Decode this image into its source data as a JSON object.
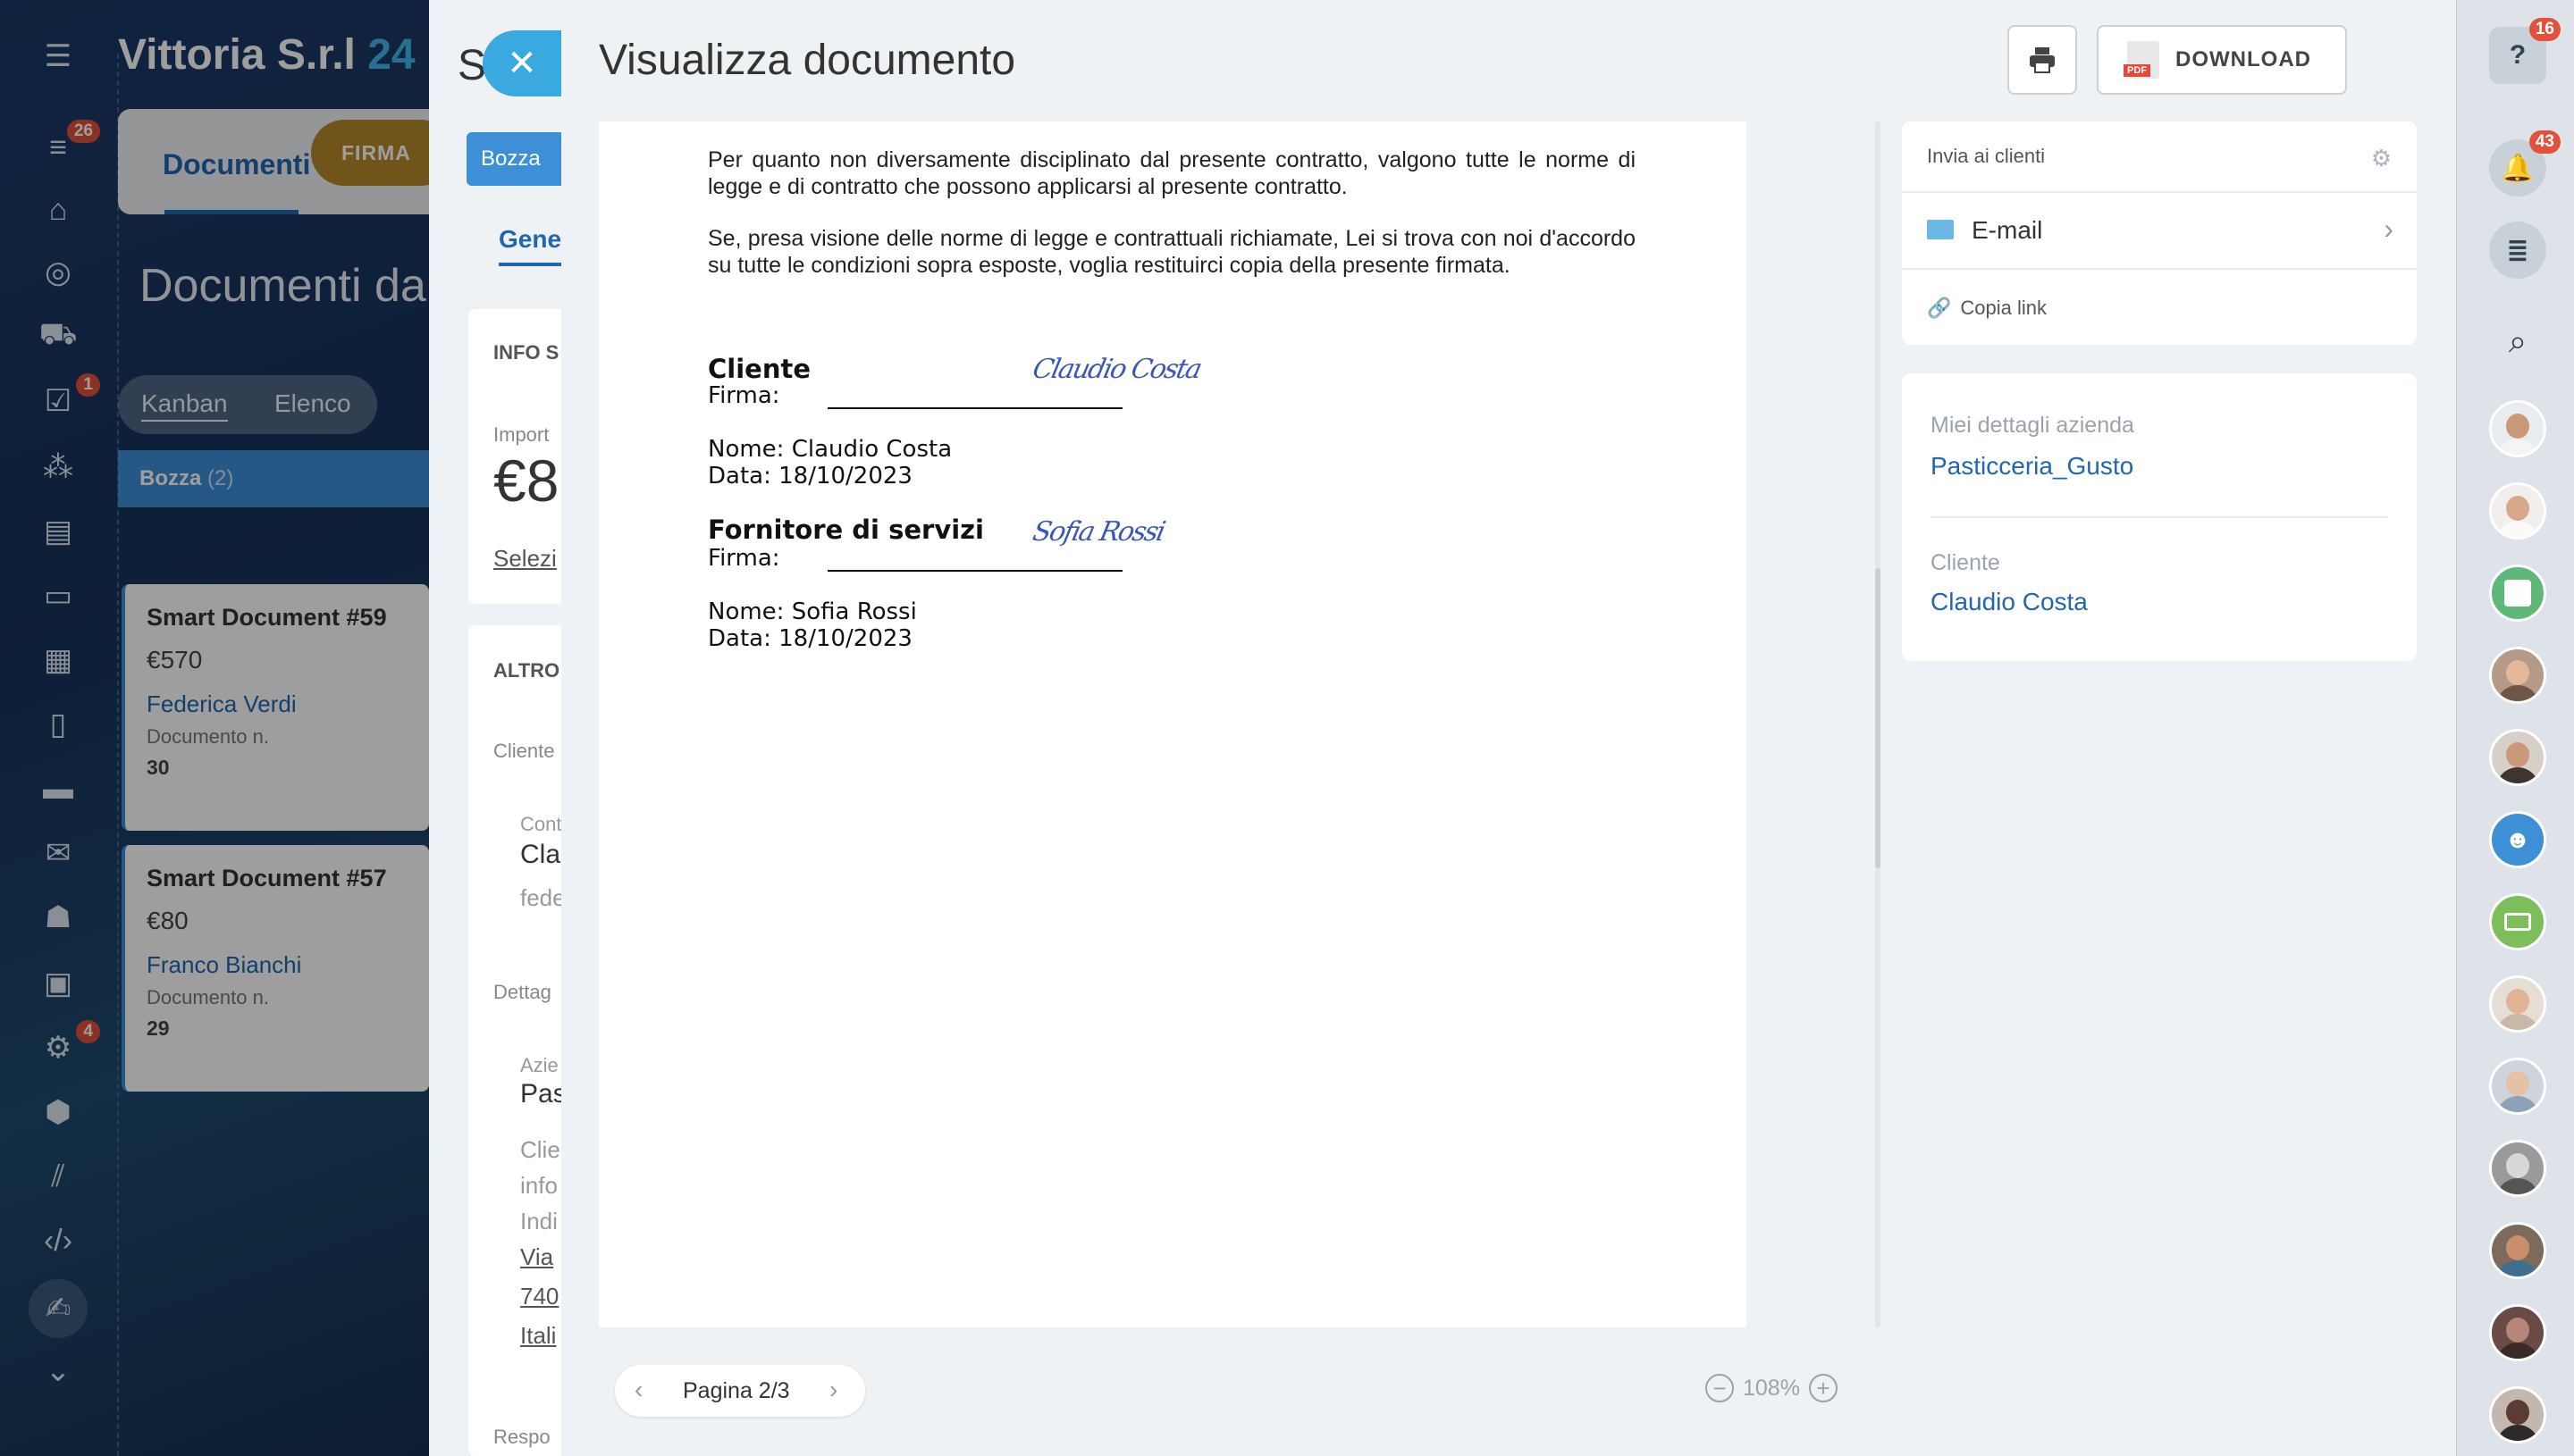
{
  "app": {
    "company_name": "Vittoria S.r.l",
    "company_suffix": "24"
  },
  "left_rail": {
    "badges": {
      "activity": "26",
      "tasks": "1",
      "robots": "4"
    }
  },
  "crm": {
    "tab_documents": "Documenti",
    "tab_firma": "FIRMA",
    "heading": "Documenti da f",
    "view_kanban": "Kanban",
    "view_elenco": "Elenco",
    "stage_name": "Bozza",
    "stage_count": "(2)",
    "cards": [
      {
        "title": "Smart Document #59",
        "amount": "€570",
        "client": "Federica Verdi",
        "doc_label": "Documento n.",
        "doc_no": "30"
      },
      {
        "title": "Smart Document #57",
        "amount": "€80",
        "client": "Franco Bianchi",
        "doc_label": "Documento n.",
        "doc_no": "29"
      }
    ]
  },
  "mid_panel": {
    "title": "S",
    "stage": "Bozza",
    "tab": "Gene",
    "info": "INFO S",
    "importo_label": "Import",
    "importo_value": "€8",
    "seleziona": "Selezi",
    "altro": "ALTRO",
    "cliente_label": "Cliente",
    "contact_label": "Cont",
    "contact_name": "Cla",
    "contact_email": "fede",
    "dettagli": "Dettag",
    "azienda_label": "Azie",
    "azienda_value": "Pas",
    "cli_label": "Clie",
    "info_label": "info",
    "indi_label": "Indi",
    "addr1": "Via",
    "addr2": "740",
    "addr3": "Itali",
    "resp": "Respo"
  },
  "viewer": {
    "title": "Visualizza documento",
    "download_label": "DOWNLOAD",
    "pdf_tag": "PDF",
    "pager": "Pagina 2/3",
    "zoom": "108%"
  },
  "document": {
    "para1": "Per quanto non diversamente disciplinato dal presente contratto, valgono tutte le norme di legge e di contratto che possono applicarsi al presente contratto.",
    "para2": "Se, presa visione delle norme di legge e contrattuali richiamate, Lei si trova con noi d'accordo su tutte le condizioni sopra esposte, voglia restituirci copia della presente firmata.",
    "client_heading": "Cliente",
    "firma_label": "Firma:",
    "client_name": "Nome: Claudio Costa",
    "client_date": "Data: 18/10/2023",
    "supplier_heading": "Fornitore di servizi",
    "supplier_name": "Nome: Sofia Rossi",
    "supplier_date": "Data: 18/10/2023"
  },
  "send_panel": {
    "heading": "Invia ai clienti",
    "email": "E-mail",
    "copy_link": "Copia link"
  },
  "details_panel": {
    "company_label": "Miei dettagli azienda",
    "company_value": "Pasticceria_Gusto",
    "client_label": "Cliente",
    "client_value": "Claudio Costa"
  },
  "right_bar": {
    "help_badge": "16",
    "notifications_badge": "43"
  },
  "colors": {
    "accent_blue": "#2067b0",
    "stage_blue": "#3d8fd6",
    "close_btn": "#39a9e0",
    "badge_red": "#e3513b",
    "firma_gold": "#b7882a"
  }
}
